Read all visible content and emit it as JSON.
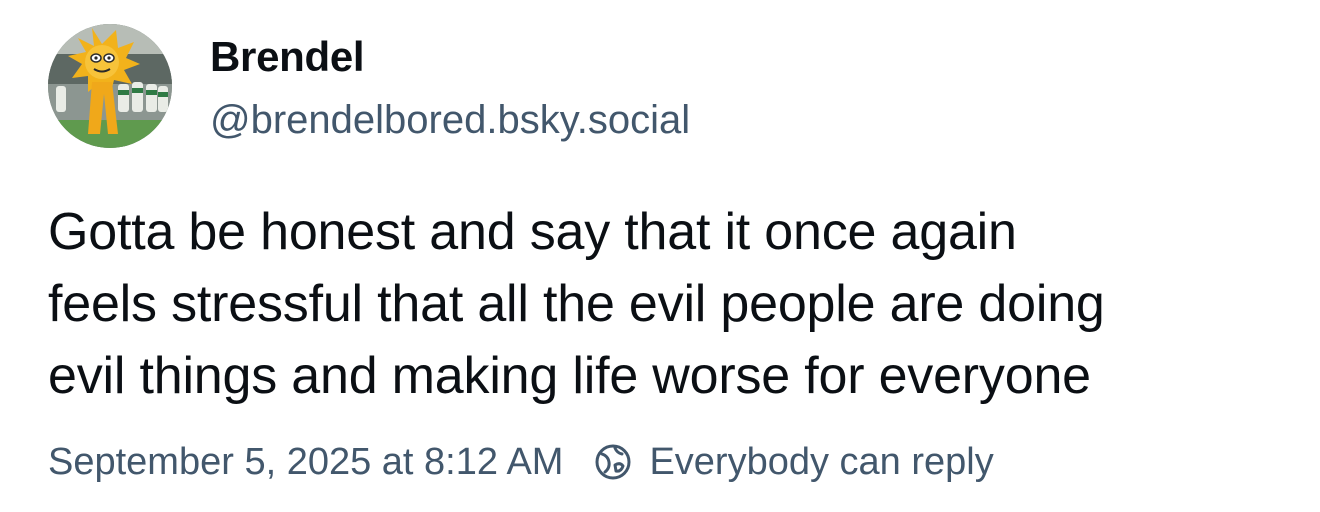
{
  "author": {
    "display_name": "Brendel",
    "handle": "@brendelbored.bsky.social",
    "avatar_icon": "avatar-mascot-image"
  },
  "post": {
    "text": "Gotta be honest and say that it once again\nfeels stressful that all the evil people are doing\nevil things and making life worse for everyone"
  },
  "meta": {
    "timestamp": "September 5, 2025 at 8:12 AM",
    "reply_setting": "Everybody can reply",
    "reply_icon": "globe-icon"
  },
  "colors": {
    "text_primary": "#0b0f14",
    "text_secondary": "#42576c",
    "background": "#ffffff"
  }
}
